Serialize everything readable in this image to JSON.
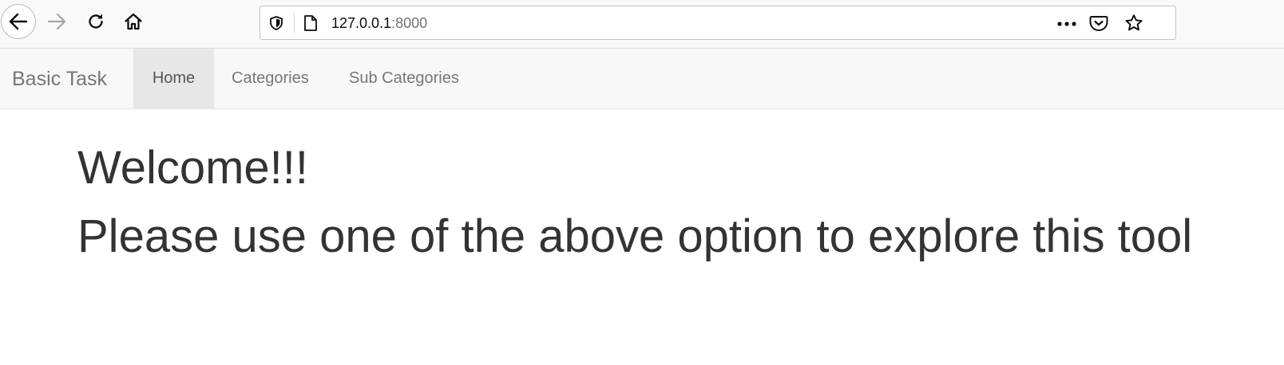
{
  "browser": {
    "url_host": "127.0.0.1",
    "url_port": ":8000",
    "icons": {
      "back": "arrow-left-icon",
      "forward": "arrow-right-icon",
      "reload": "reload-icon",
      "home": "home-icon",
      "tracking": "shield-icon",
      "page": "page-icon",
      "more": "ellipsis-icon",
      "pocket": "pocket-icon",
      "bookmark": "star-icon"
    },
    "forward_enabled": false
  },
  "navbar": {
    "brand": "Basic Task",
    "items": [
      {
        "label": "Home",
        "active": true
      },
      {
        "label": "Categories",
        "active": false
      },
      {
        "label": "Sub Categories",
        "active": false
      }
    ],
    "active_bg": "#e7e7e7"
  },
  "content": {
    "heading": "Welcome!!!",
    "subheading": "Please use one of the above option to explore this tool"
  }
}
